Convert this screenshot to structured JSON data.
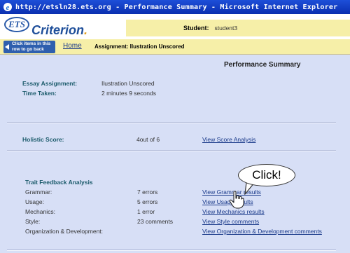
{
  "window": {
    "title": "http://etsln28.ets.org - Performance Summary - Microsoft Internet Explorer"
  },
  "header": {
    "ets_logo": "ETS",
    "brand": "Criterion",
    "student_label": "Student:",
    "student_value": "student3"
  },
  "nav": {
    "hint": "Click items in this row to go back",
    "home": "Home",
    "assignment": "Assignment: Ilustration Unscored"
  },
  "summary": {
    "title": "Performance Summary",
    "essay_label": "Essay Assignment:",
    "essay_value": "Ilustration Unscored",
    "time_label": "Time Taken:",
    "time_value": "2 minutes 9 seconds"
  },
  "holistic": {
    "label": "Holistic Score:",
    "value": "4out of 6",
    "link": "View Score Analysis"
  },
  "traits": {
    "title": "Trait Feedback Analysis",
    "rows": [
      {
        "name": "Grammar:",
        "value": "7 errors",
        "link": "View Grammar results"
      },
      {
        "name": "Usage:",
        "value": "5 errors",
        "link": "View Usage results"
      },
      {
        "name": "Mechanics:",
        "value": "1 error",
        "link": "View Mechanics results"
      },
      {
        "name": "Style:",
        "value": "23 comments",
        "link": "View Style comments"
      },
      {
        "name": "Organization & Development:",
        "value": "",
        "link": "View Organization & Development comments"
      }
    ]
  },
  "callout": {
    "text": "Click!"
  },
  "colors": {
    "titlebar": "#0a2fb0",
    "header_yellow": "#f6efa8",
    "content_bg": "#d7dff6",
    "link": "#1a3a8a"
  },
  "icons": [
    "ie-icon",
    "ets-logo",
    "back-arrow-icon",
    "hand-pointer-icon"
  ]
}
